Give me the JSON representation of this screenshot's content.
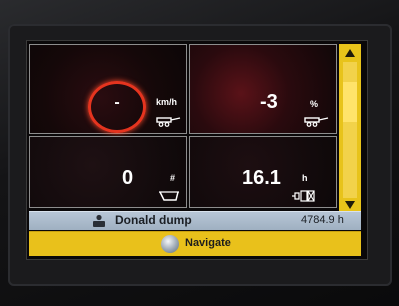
{
  "display": {
    "speed": {
      "value": "-",
      "unit": "km/h",
      "icon": "trailer-speed-icon"
    },
    "slip": {
      "value": "-3",
      "unit": "%",
      "icon": "trailer-slip-icon"
    },
    "count": {
      "value": "0",
      "unit": "#",
      "icon": "dump-body-icon"
    },
    "hours": {
      "value": "16.1",
      "unit": "h",
      "icon": "engine-hours-icon"
    }
  },
  "status_bar": {
    "operator_name": "Donald",
    "mode": "dump",
    "total_hours": "4784.9 h",
    "icon": "operator-icon"
  },
  "nav_bar": {
    "label": "Navigate",
    "icon": "joystick-button-icon"
  },
  "colors": {
    "accent_yellow": "#e9c11b",
    "gauge_red": "#e5341f",
    "status_blue": "#a9b9ca"
  }
}
